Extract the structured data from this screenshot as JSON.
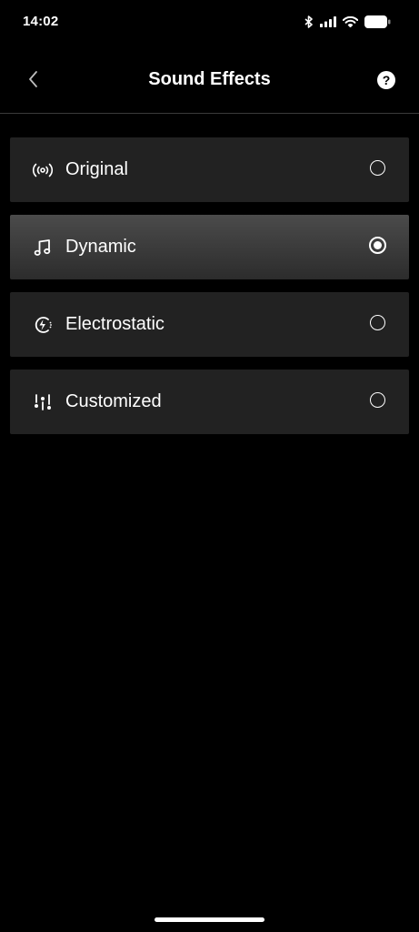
{
  "status_bar": {
    "time": "14:02",
    "icons": [
      "bluetooth-icon",
      "signal-icon",
      "wifi-icon",
      "battery-icon"
    ]
  },
  "header": {
    "title": "Sound Effects",
    "back_icon": "chevron-left-icon",
    "help_label": "?"
  },
  "options": [
    {
      "label": "Original",
      "icon": "broadcast-icon",
      "selected": false
    },
    {
      "label": "Dynamic",
      "icon": "music-note-icon",
      "selected": true
    },
    {
      "label": "Electrostatic",
      "icon": "lightning-icon",
      "selected": false
    },
    {
      "label": "Customized",
      "icon": "equalizer-icon",
      "selected": false
    }
  ],
  "colors": {
    "background": "#000000",
    "option_bg": "#222222",
    "option_selected_bg": "#404040",
    "text": "#ffffff"
  }
}
